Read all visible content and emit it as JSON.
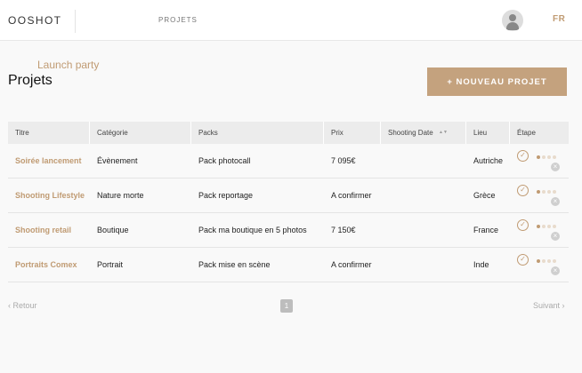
{
  "header": {
    "logo": "OOSHOT",
    "nav_projects": "PROJETS",
    "language": "FR",
    "avatar_icon": "user-avatar-icon"
  },
  "page": {
    "subtitle": "Launch party",
    "title": "Projets",
    "new_project_label": "+ NOUVEAU PROJET"
  },
  "table": {
    "columns": [
      "Titre",
      "Catégorie",
      "Packs",
      "Prix",
      "Shooting Date",
      "Lieu",
      "Étape"
    ],
    "sort_icon": "sort-arrows-icon",
    "rows": [
      {
        "title": "Soirée lancement",
        "category": "Évènement",
        "pack": "Pack photocall",
        "price": "7 095€",
        "date": "",
        "place": "Autriche",
        "check_icon": "check-circle-icon"
      },
      {
        "title": "Shooting Lifestyle",
        "category": "Nature morte",
        "pack": "Pack reportage",
        "price": "A confirmer",
        "date": "",
        "place": "Grèce",
        "check_icon": "check-circle-icon"
      },
      {
        "title": "Shooting retail",
        "category": "Boutique",
        "pack": "Pack ma boutique en 5 photos",
        "price": "7 150€",
        "date": "",
        "place": "France",
        "check_icon": "check-circle-icon"
      },
      {
        "title": "Portraits Comex",
        "category": "Portrait",
        "pack": "Pack mise en scène",
        "price": "A confirmer",
        "date": "",
        "place": "Inde",
        "check_icon": "check-circle-icon"
      }
    ]
  },
  "pagination": {
    "prev_label": "Retour",
    "next_label": "Suivant",
    "current_page": "1"
  },
  "colors": {
    "accent": "#c09b73",
    "button": "#c4a27e"
  }
}
